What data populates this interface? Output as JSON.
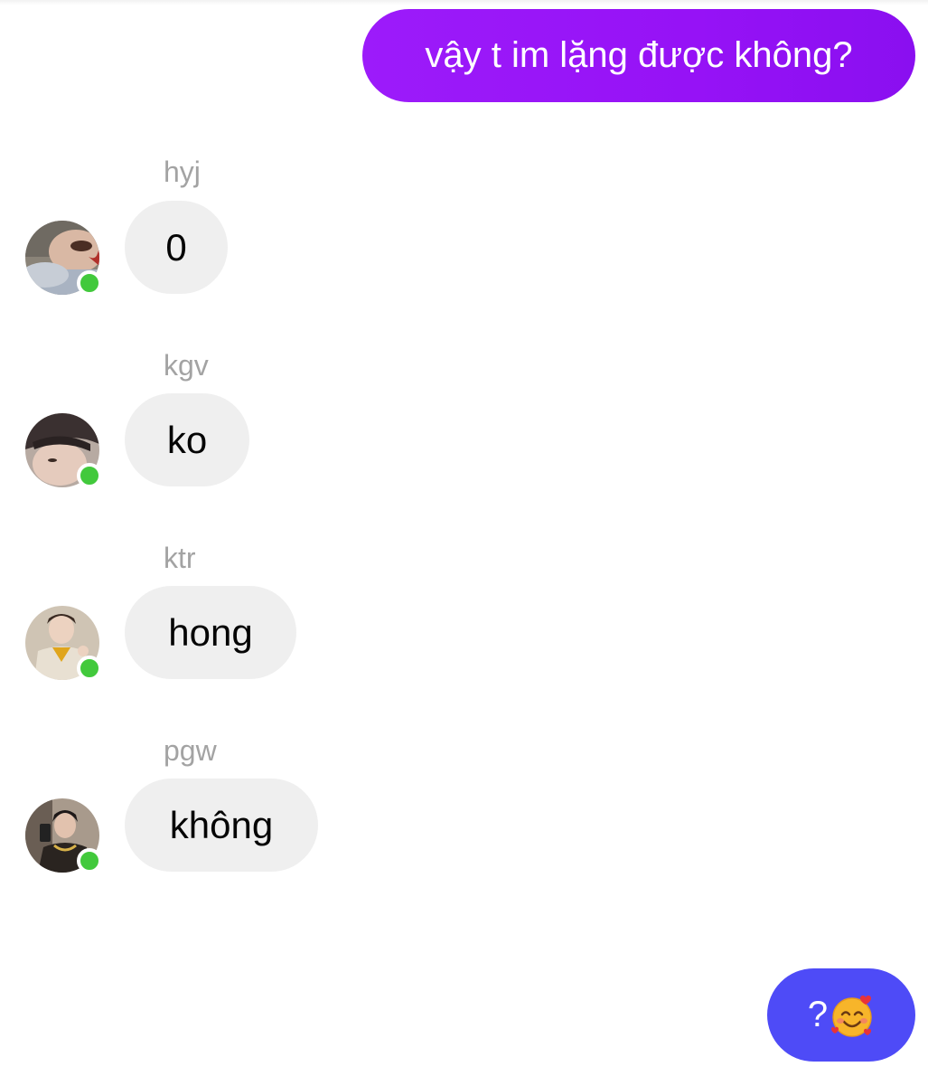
{
  "outgoing": [
    {
      "text": "vậy t im lặng được không?",
      "color": "#9a14f8"
    },
    {
      "text": "?",
      "emoji": "smiling-face-with-hearts",
      "color": "#4e4bf7"
    }
  ],
  "incoming": [
    {
      "sender": "hyj",
      "text": "0",
      "online": true
    },
    {
      "sender": "kgv",
      "text": "ko",
      "online": true
    },
    {
      "sender": "ktr",
      "text": "hong",
      "online": true
    },
    {
      "sender": "pgw",
      "text": "không",
      "online": true
    }
  ],
  "colors": {
    "incoming_bubble": "#efefef",
    "sender_name": "#a3a3a3",
    "online_dot": "#42c93c"
  }
}
